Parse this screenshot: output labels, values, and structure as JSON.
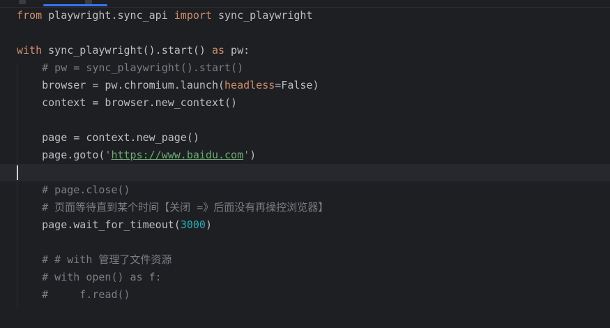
{
  "editor": {
    "lines": [
      {
        "segments": [
          {
            "t": "from",
            "c": "kw"
          },
          {
            "t": " playwright.sync_api ",
            "c": "plain"
          },
          {
            "t": "import",
            "c": "kw"
          },
          {
            "t": " sync_playwright",
            "c": "plain"
          }
        ]
      },
      {
        "segments": []
      },
      {
        "segments": [
          {
            "t": "with",
            "c": "kw"
          },
          {
            "t": " sync_playwright().start() ",
            "c": "plain"
          },
          {
            "t": "as",
            "c": "kw"
          },
          {
            "t": " pw:",
            "c": "plain"
          }
        ]
      },
      {
        "segments": [
          {
            "t": "    # pw = sync_playwright().start()",
            "c": "cm"
          }
        ]
      },
      {
        "segments": [
          {
            "t": "    browser = pw.chromium.launch(",
            "c": "plain"
          },
          {
            "t": "headless",
            "c": "param"
          },
          {
            "t": "=False)",
            "c": "plain"
          }
        ]
      },
      {
        "segments": [
          {
            "t": "    context = browser.new_context()",
            "c": "plain"
          }
        ]
      },
      {
        "segments": []
      },
      {
        "segments": [
          {
            "t": "    page = context.new_page()",
            "c": "plain"
          }
        ]
      },
      {
        "segments": [
          {
            "t": "    page.goto(",
            "c": "plain"
          },
          {
            "t": "'",
            "c": "str"
          },
          {
            "t": "https://www.baidu.com",
            "c": "url"
          },
          {
            "t": "'",
            "c": "str"
          },
          {
            "t": ")",
            "c": "plain"
          }
        ]
      },
      {
        "segments": [],
        "current": true
      },
      {
        "segments": [
          {
            "t": "    # page.close()",
            "c": "cm"
          }
        ]
      },
      {
        "segments": [
          {
            "t": "    # 页面等待直到某个时间【关闭 =》后面没有再操控浏览器】",
            "c": "cm"
          }
        ]
      },
      {
        "segments": [
          {
            "t": "    page.wait_for_timeout(",
            "c": "plain"
          },
          {
            "t": "3000",
            "c": "num"
          },
          {
            "t": ")",
            "c": "plain"
          }
        ]
      },
      {
        "segments": []
      },
      {
        "segments": [
          {
            "t": "    # # with 管理了文件资源",
            "c": "cm"
          }
        ]
      },
      {
        "segments": [
          {
            "t": "    # with open() as f:",
            "c": "cm"
          }
        ]
      },
      {
        "segments": [
          {
            "t": "    #     f.read()",
            "c": "cm"
          }
        ]
      },
      {
        "segments": []
      }
    ]
  },
  "colors": {
    "background": "#1e1f22",
    "keyword": "#cf8e6d",
    "comment": "#7a7e85",
    "string": "#6aab73",
    "number": "#2aacb8",
    "text": "#bcbec4",
    "active_tab_underline": "#3574f0"
  }
}
